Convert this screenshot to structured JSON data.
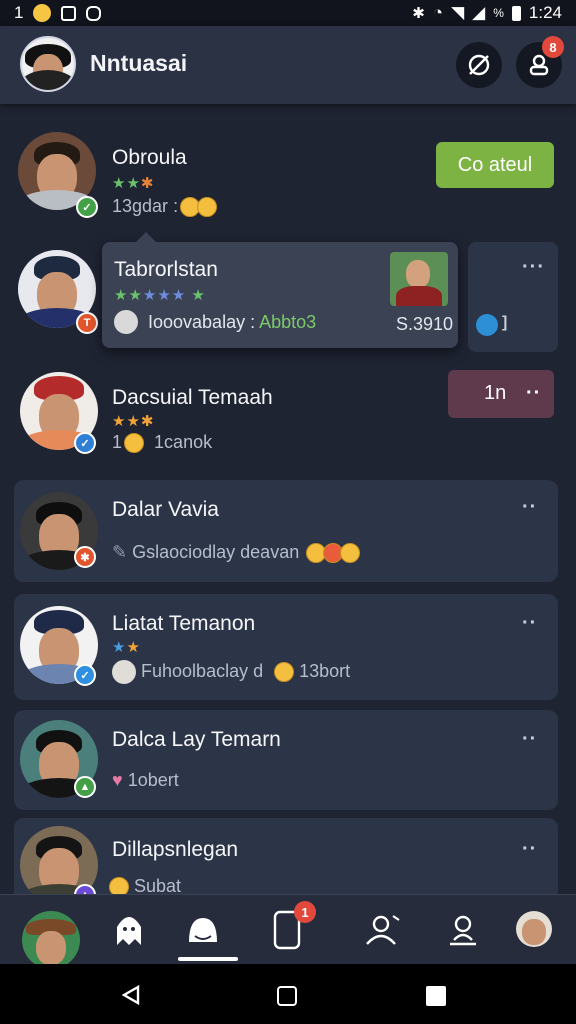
{
  "status_bar": {
    "left_number": "1",
    "time": "1:24",
    "percent": "%"
  },
  "header": {
    "title": "Nntuasai",
    "notification_count": "8"
  },
  "contacts": [
    {
      "name": "Obroula",
      "status_text": "13gdar",
      "button": "Co ateul"
    },
    {
      "name": "Tabrorlstan",
      "preview": "Iooovabalay :",
      "preview_highlight": "Abbto3",
      "amount": "S.3910"
    },
    {
      "name": "Dacsuial Temaah",
      "status_text": "1",
      "status_text_2": "1canok",
      "button": "1n"
    },
    {
      "name": "Dalar Vavia",
      "status_text": "Gslaociodlay deavan"
    },
    {
      "name": "Liatat Temanon",
      "status_text": "Fuhoolbaclay d",
      "status_text_2": "13bort"
    },
    {
      "name": "Dalca Lay Temarn",
      "status_text": "1obert"
    },
    {
      "name": "Dillapsnlegan",
      "status_text": "Subat"
    }
  ],
  "nav": {
    "badge": "1"
  },
  "colors": {
    "accent_green": "#7cb342",
    "badge_red": "#e2483b"
  }
}
